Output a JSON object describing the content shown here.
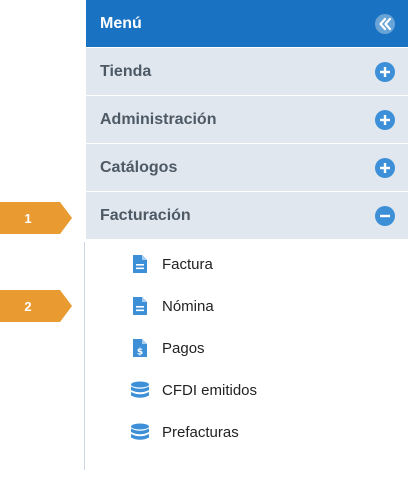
{
  "menu": {
    "title": "Menú",
    "sections": [
      {
        "label": "Tienda",
        "state": "collapsed"
      },
      {
        "label": "Administración",
        "state": "collapsed"
      },
      {
        "label": "Catálogos",
        "state": "collapsed"
      },
      {
        "label": "Facturación",
        "state": "expanded"
      }
    ],
    "items": [
      {
        "label": "Factura",
        "icon": "document-icon"
      },
      {
        "label": "Nómina",
        "icon": "document-icon"
      },
      {
        "label": "Pagos",
        "icon": "dollar-document-icon"
      },
      {
        "label": "CFDI emitidos",
        "icon": "database-icon"
      },
      {
        "label": "Prefacturas",
        "icon": "database-icon"
      }
    ]
  },
  "markers": [
    {
      "label": "1"
    },
    {
      "label": "2"
    }
  ],
  "colors": {
    "header_bg": "#1a73c2",
    "section_bg": "#e1e7ee",
    "section_text": "#4d5964",
    "icon_blue": "#3d8fd8",
    "marker_orange": "#e99a30"
  }
}
